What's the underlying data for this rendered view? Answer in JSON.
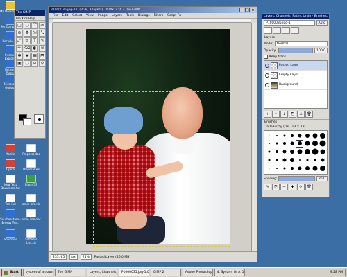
{
  "desktop": {
    "icons": [
      {
        "label": "My Documents",
        "kind": "yellow"
      },
      {
        "label": "My Computer",
        "kind": "blue"
      },
      {
        "label": "Recycle Bin",
        "kind": "blue"
      },
      {
        "label": "Internet Explorer",
        "kind": "blue"
      },
      {
        "label": "Network Places",
        "kind": "blue"
      },
      {
        "label": "Microsoft Outlook",
        "kind": "blue"
      },
      {
        "label": "Mozilla",
        "kind": "mod"
      },
      {
        "label": "Proposal.doc",
        "kind": "doc"
      },
      {
        "label": "Opera",
        "kind": "mod"
      },
      {
        "label": "Proposal.xls",
        "kind": "doc"
      },
      {
        "label": "New Text Document.txt",
        "kind": "doc"
      },
      {
        "label": "FlashFXP",
        "kind": "green"
      },
      {
        "label": "Test Ext",
        "kind": "doc"
      },
      {
        "label": "arnie info.xls",
        "kind": "doc"
      },
      {
        "label": "Southeastern - Energy Tra...",
        "kind": "blue"
      },
      {
        "label": "arnie info.doc",
        "kind": "doc"
      },
      {
        "label": "Solutions",
        "kind": "blue"
      },
      {
        "label": "Software List.xls",
        "kind": "doc"
      }
    ]
  },
  "toolbox": {
    "title": "The GIMP",
    "menu": "File  Xtns  Help",
    "tools": [
      "□",
      "○",
      "⌒",
      "✂",
      "⊕",
      "✥",
      "⇲",
      "⤡",
      "⤢",
      "⇄",
      "T",
      "✎",
      "✏",
      "⌫",
      "◐",
      "≋",
      "✱",
      "◈",
      "▦",
      "⬒",
      "▣",
      "◌",
      "⊘",
      "⚲"
    ]
  },
  "image_window": {
    "title": "P1000035.jpg-1.0 (RGB, 3 layers) 1024x1416 – The GIMP",
    "menus": [
      "File",
      "Edit",
      "Select",
      "View",
      "Image",
      "Layers",
      "Tools",
      "Dialogs",
      "Filters",
      "Script-Fu"
    ],
    "status_units": "px",
    "status_zoom": "25%",
    "status_text": "Pasted Layer (46.0 MB)",
    "status_coords": "233, 65",
    "win_buttons": [
      "_",
      "□",
      "×"
    ]
  },
  "layers_dialog": {
    "title": "Layers, Channels, Paths, Undo - Brushes, Patterns, Gradients",
    "image_select": "P1000035.jpg-1",
    "auto_button": "Auto",
    "section_label": "Layers",
    "mode_label": "Mode:",
    "mode_value": "Normal",
    "opacity_label": "Opacity:",
    "opacity_value": "100.0",
    "keep_trans_label": "Keep trans.",
    "layers": [
      {
        "name": "Pasted Layer",
        "selected": true,
        "thumb": "checker"
      },
      {
        "name": "Empty Layer",
        "selected": false,
        "thumb": "checker"
      },
      {
        "name": "Background",
        "selected": false,
        "thumb": "photo"
      }
    ],
    "layer_tools": [
      "+",
      "↑",
      "↓",
      "⎘",
      "⚓",
      "🗑"
    ],
    "brushes_label": "Brushes",
    "brush_name": "Circle Fuzzy (09) (13 × 13)",
    "spacing_label": "Spacing:",
    "spacing_value": "25.0",
    "brush_sizes": [
      1,
      2,
      3,
      4,
      5,
      6,
      7,
      8,
      2,
      3,
      4,
      5,
      6,
      7,
      8,
      9,
      3,
      4,
      5,
      6,
      7,
      8,
      9,
      7,
      3,
      4,
      5,
      6,
      2,
      3,
      4,
      5,
      1,
      2,
      3,
      4,
      5,
      6,
      7,
      8
    ],
    "brush_tools": [
      "✎",
      "⎘",
      "✂",
      "✚",
      "⟳",
      "🗑"
    ]
  },
  "taskbar": {
    "start": "Start",
    "tasks": [
      {
        "label": "system of a down",
        "active": false
      },
      {
        "label": "The GIMP",
        "active": false
      },
      {
        "label": "Layers, Channels, P...",
        "active": false
      },
      {
        "label": "P1000035.jpg-1.0 (R...",
        "active": true
      },
      {
        "label": "GIMP 2",
        "active": false
      },
      {
        "label": "Adobe Photoshop",
        "active": false
      },
      {
        "label": "4. System Of A Dow...",
        "active": false
      }
    ],
    "clock": "9:28 PM"
  }
}
